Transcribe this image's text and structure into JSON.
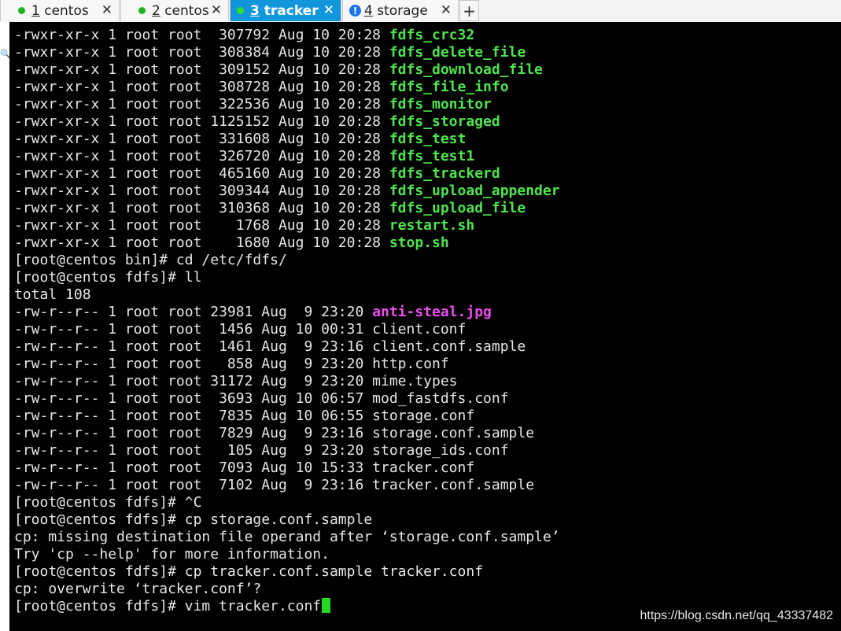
{
  "tabs": [
    {
      "num": "1",
      "name": " centos",
      "status": "connected",
      "active": false
    },
    {
      "num": "2",
      "name": " centos",
      "status": "connected",
      "active": false
    },
    {
      "num": "3",
      "name": " tracker",
      "status": "connected",
      "active": true
    },
    {
      "num": "4",
      "name": " storage",
      "status": "info",
      "active": false
    }
  ],
  "tab_close_glyph": "✕",
  "add_tab_glyph": "+",
  "info_glyph": "!",
  "terminal": {
    "lines": [
      {
        "text": "-rwxr-xr-x 1 root root  307792 Aug 10 20:28 ",
        "hl": "fdfs_crc32",
        "hl_color": "green"
      },
      {
        "text": "-rwxr-xr-x 1 root root  308384 Aug 10 20:28 ",
        "hl": "fdfs_delete_file",
        "hl_color": "green"
      },
      {
        "text": "-rwxr-xr-x 1 root root  309152 Aug 10 20:28 ",
        "hl": "fdfs_download_file",
        "hl_color": "green"
      },
      {
        "text": "-rwxr-xr-x 1 root root  308728 Aug 10 20:28 ",
        "hl": "fdfs_file_info",
        "hl_color": "green"
      },
      {
        "text": "-rwxr-xr-x 1 root root  322536 Aug 10 20:28 ",
        "hl": "fdfs_monitor",
        "hl_color": "green"
      },
      {
        "text": "-rwxr-xr-x 1 root root 1125152 Aug 10 20:28 ",
        "hl": "fdfs_storaged",
        "hl_color": "green"
      },
      {
        "text": "-rwxr-xr-x 1 root root  331608 Aug 10 20:28 ",
        "hl": "fdfs_test",
        "hl_color": "green"
      },
      {
        "text": "-rwxr-xr-x 1 root root  326720 Aug 10 20:28 ",
        "hl": "fdfs_test1",
        "hl_color": "green"
      },
      {
        "text": "-rwxr-xr-x 1 root root  465160 Aug 10 20:28 ",
        "hl": "fdfs_trackerd",
        "hl_color": "green"
      },
      {
        "text": "-rwxr-xr-x 1 root root  309344 Aug 10 20:28 ",
        "hl": "fdfs_upload_appender",
        "hl_color": "green"
      },
      {
        "text": "-rwxr-xr-x 1 root root  310368 Aug 10 20:28 ",
        "hl": "fdfs_upload_file",
        "hl_color": "green"
      },
      {
        "text": "-rwxr-xr-x 1 root root    1768 Aug 10 20:28 ",
        "hl": "restart.sh",
        "hl_color": "green"
      },
      {
        "text": "-rwxr-xr-x 1 root root    1680 Aug 10 20:28 ",
        "hl": "stop.sh",
        "hl_color": "green"
      },
      {
        "text": "[root@centos bin]# cd /etc/fdfs/"
      },
      {
        "text": "[root@centos fdfs]# ll"
      },
      {
        "text": "total 108"
      },
      {
        "text": "-rw-r--r-- 1 root root 23981 Aug  9 23:20 ",
        "hl": "anti-steal.jpg",
        "hl_color": "magenta"
      },
      {
        "text": "-rw-r--r-- 1 root root  1456 Aug 10 00:31 client.conf"
      },
      {
        "text": "-rw-r--r-- 1 root root  1461 Aug  9 23:16 client.conf.sample"
      },
      {
        "text": "-rw-r--r-- 1 root root   858 Aug  9 23:20 http.conf"
      },
      {
        "text": "-rw-r--r-- 1 root root 31172 Aug  9 23:20 mime.types"
      },
      {
        "text": "-rw-r--r-- 1 root root  3693 Aug 10 06:57 mod_fastdfs.conf"
      },
      {
        "text": "-rw-r--r-- 1 root root  7835 Aug 10 06:55 storage.conf"
      },
      {
        "text": "-rw-r--r-- 1 root root  7829 Aug  9 23:16 storage.conf.sample"
      },
      {
        "text": "-rw-r--r-- 1 root root   105 Aug  9 23:20 storage_ids.conf"
      },
      {
        "text": "-rw-r--r-- 1 root root  7093 Aug 10 15:33 tracker.conf"
      },
      {
        "text": "-rw-r--r-- 1 root root  7102 Aug  9 23:16 tracker.conf.sample"
      },
      {
        "text": "[root@centos fdfs]# ^C"
      },
      {
        "text": "[root@centos fdfs]# cp storage.conf.sample"
      },
      {
        "text": "cp: missing destination file operand after ‘storage.conf.sample’"
      },
      {
        "text": "Try 'cp --help' for more information."
      },
      {
        "text": "[root@centos fdfs]# cp tracker.conf.sample tracker.conf"
      },
      {
        "text": "cp: overwrite ‘tracker.conf’?"
      },
      {
        "text": "[root@centos fdfs]# vim tracker.conf",
        "cursor": true
      }
    ]
  },
  "watermark": "https://blog.csdn.net/qq_43337482",
  "colors": {
    "terminal_bg": "#000000",
    "terminal_fg": "#e6e6e6",
    "exec_green": "#4ee44e",
    "image_magenta": "#ef4cef",
    "active_tab": "#1296db",
    "cursor": "#23d823"
  }
}
